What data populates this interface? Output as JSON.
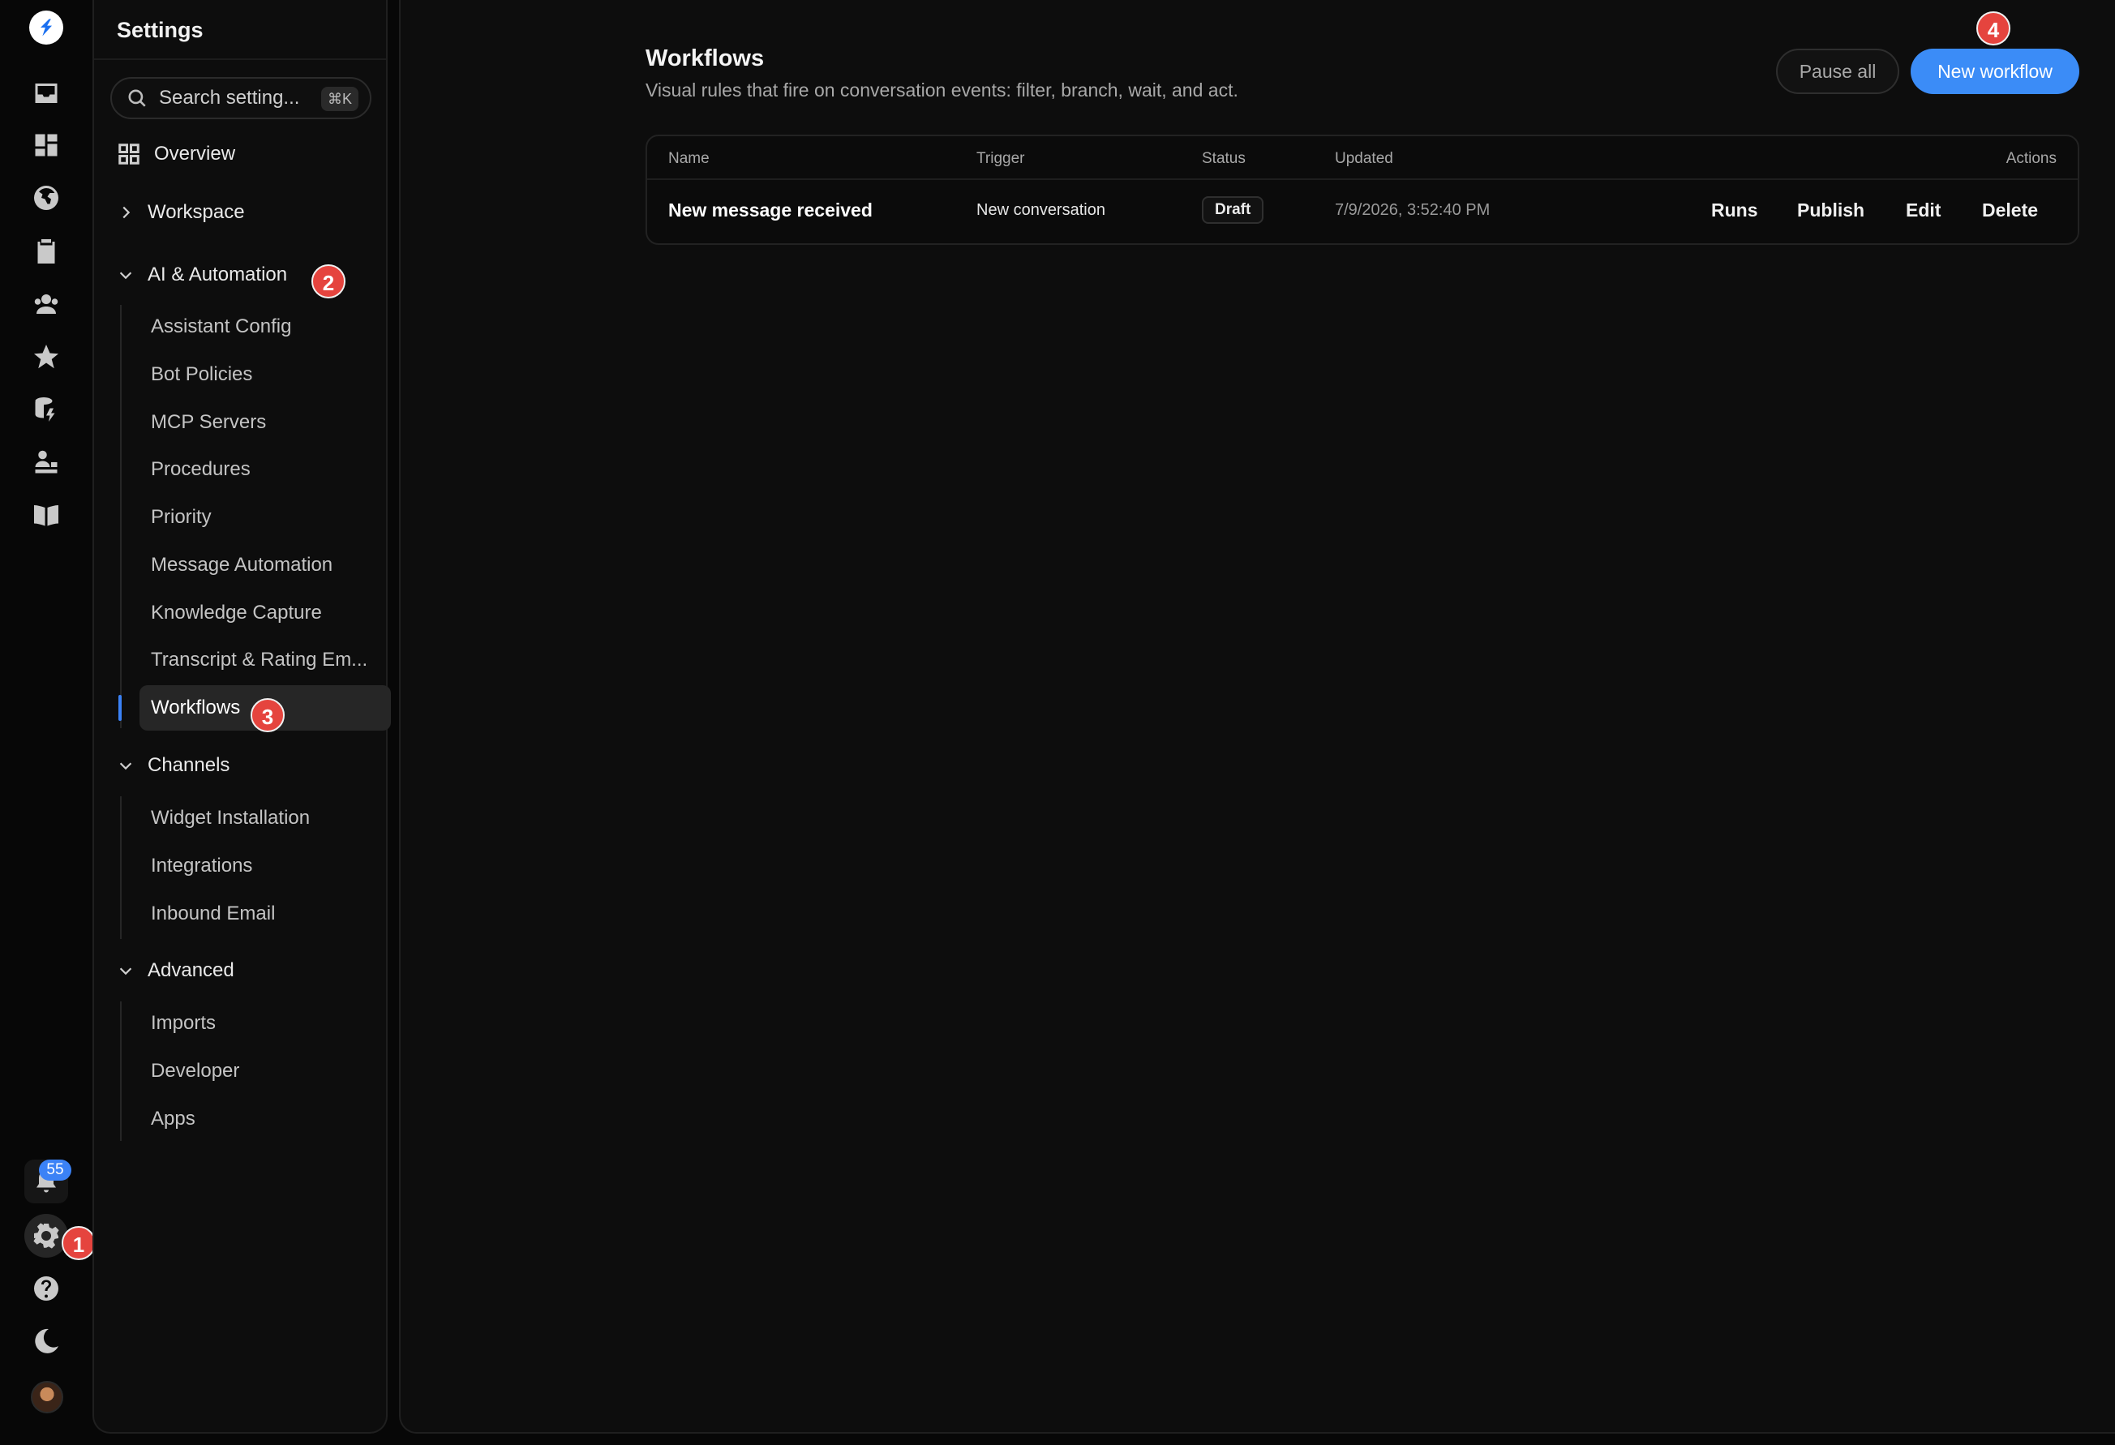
{
  "notifications": {
    "count": "55"
  },
  "steps": {
    "s1": "1",
    "s2": "2",
    "s3": "3",
    "s4": "4"
  },
  "settings": {
    "title": "Settings",
    "search_placeholder": "Search setting...",
    "search_shortcut": "⌘K",
    "overview": "Overview",
    "workspace": "Workspace",
    "groups": [
      {
        "label": "AI & Automation",
        "items": [
          "Assistant Config",
          "Bot Policies",
          "MCP Servers",
          "Procedures",
          "Priority",
          "Message Automation",
          "Knowledge Capture",
          "Transcript & Rating Em...",
          "Workflows"
        ]
      },
      {
        "label": "Channels",
        "items": [
          "Widget Installation",
          "Integrations",
          "Inbound Email"
        ]
      },
      {
        "label": "Advanced",
        "items": [
          "Imports",
          "Developer",
          "Apps"
        ]
      }
    ],
    "active_item": "Workflows"
  },
  "page": {
    "title": "Workflows",
    "subtitle": "Visual rules that fire on conversation events: filter, branch, wait, and act.",
    "pause_all": "Pause all",
    "new_workflow": "New workflow"
  },
  "table": {
    "columns": [
      "Name",
      "Trigger",
      "Status",
      "Updated",
      "Actions"
    ],
    "rows": [
      {
        "name": "New message received",
        "trigger": "New conversation",
        "status": "Draft",
        "updated": "7/9/2026, 3:52:40 PM",
        "actions": [
          "Runs",
          "Publish",
          "Edit",
          "Delete"
        ]
      }
    ]
  },
  "colors": {
    "accent": "#3b8cf7",
    "step_badge": "#e5443e",
    "background": "#0d0d0d"
  }
}
